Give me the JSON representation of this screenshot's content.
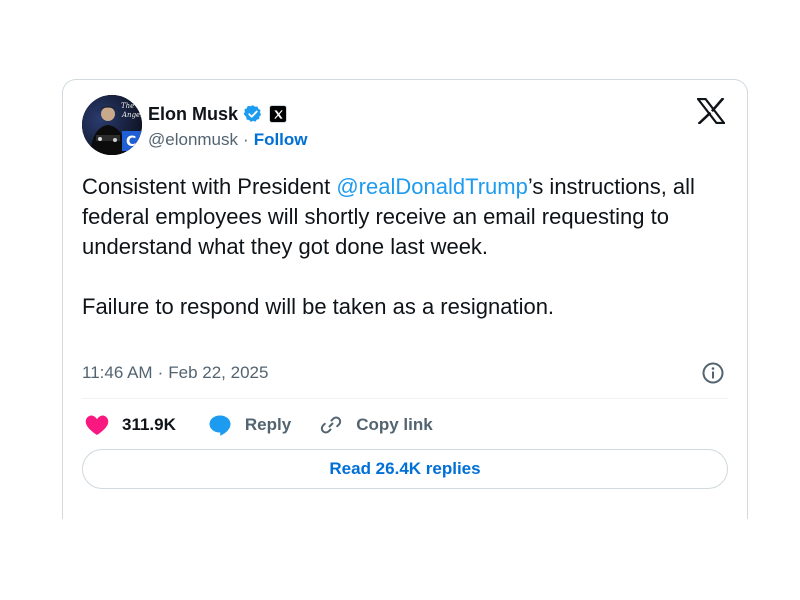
{
  "author": {
    "display_name": "Elon Musk",
    "handle": "@elonmusk",
    "separator": "·",
    "follow_label": "Follow",
    "verified": true,
    "verified_color": "#1d9bf0"
  },
  "tweet": {
    "text_part1": "Consistent with President ",
    "mention": "@realDonaldTrump",
    "text_part2": "’s instructions, all federal employees will shortly receive an email requesting to understand what they got done last week.",
    "paragraph2": "Failure to respond will be taken as a resignation.",
    "time": "11:46 AM",
    "separator": "·",
    "date": "Feb 22, 2025"
  },
  "actions": {
    "like_count": "311.9K",
    "reply_label": "Reply",
    "copy_link_label": "Copy link",
    "read_replies_label": "Read 26.4K replies"
  },
  "icons": {
    "platform": "x-logo-icon",
    "verified": "verified-badge-icon",
    "affiliate": "x-affiliate-badge-icon",
    "info": "info-icon",
    "like": "heart-icon",
    "reply": "speech-bubble-icon",
    "copy_link": "link-icon"
  },
  "colors": {
    "text_primary": "#0f1419",
    "text_secondary": "#536471",
    "link": "#1d9bf0",
    "link_bold": "#006fd6",
    "heart": "#f91880",
    "border": "#cfd9de"
  }
}
